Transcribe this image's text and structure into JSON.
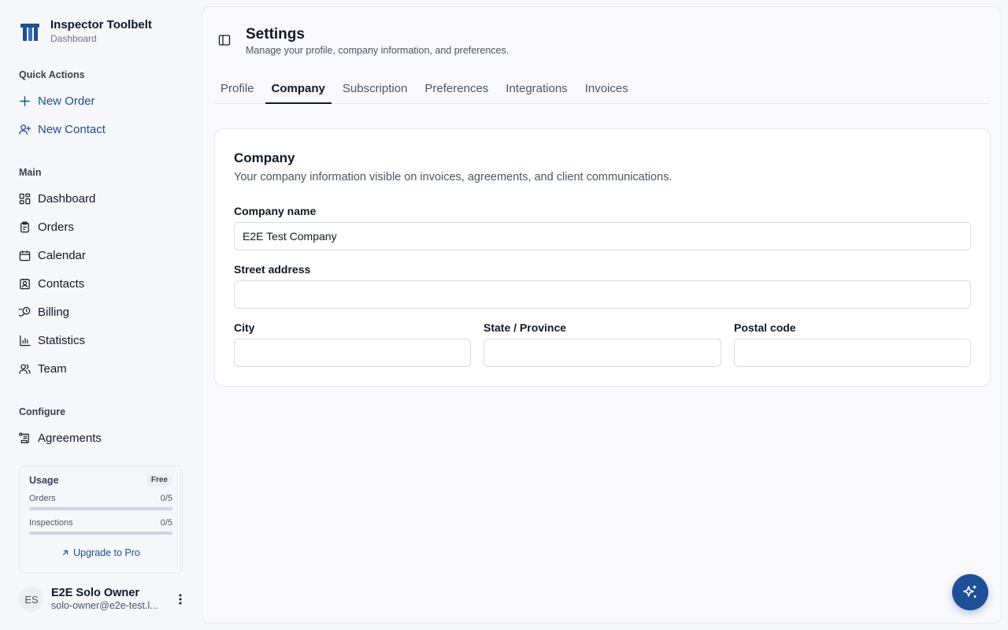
{
  "brand": {
    "title": "Inspector Toolbelt",
    "subtitle": "Dashboard"
  },
  "sidebar": {
    "quick_actions_label": "Quick Actions",
    "quick_actions": [
      {
        "label": "New Order",
        "icon": "plus-icon"
      },
      {
        "label": "New Contact",
        "icon": "user-plus-icon"
      }
    ],
    "main_label": "Main",
    "main_items": [
      {
        "label": "Dashboard",
        "icon": "dashboard-icon"
      },
      {
        "label": "Orders",
        "icon": "clipboard-icon"
      },
      {
        "label": "Calendar",
        "icon": "calendar-icon"
      },
      {
        "label": "Contacts",
        "icon": "contact-card-icon"
      },
      {
        "label": "Billing",
        "icon": "coins-icon"
      },
      {
        "label": "Statistics",
        "icon": "bar-chart-icon"
      },
      {
        "label": "Team",
        "icon": "users-icon"
      }
    ],
    "configure_label": "Configure",
    "configure_items": [
      {
        "label": "Agreements",
        "icon": "scroll-icon"
      }
    ]
  },
  "usage": {
    "title": "Usage",
    "plan_badge": "Free",
    "meters": [
      {
        "label": "Orders",
        "value": "0/5",
        "fraction": 0
      },
      {
        "label": "Inspections",
        "value": "0/5",
        "fraction": 0
      }
    ],
    "upgrade_label": "Upgrade to Pro"
  },
  "user": {
    "initials": "ES",
    "name": "E2E Solo Owner",
    "email": "solo-owner@e2e-test.l..."
  },
  "header": {
    "title": "Settings",
    "subtitle": "Manage your profile, company information, and preferences."
  },
  "tabs": [
    {
      "label": "Profile",
      "active": false
    },
    {
      "label": "Company",
      "active": true
    },
    {
      "label": "Subscription",
      "active": false
    },
    {
      "label": "Preferences",
      "active": false
    },
    {
      "label": "Integrations",
      "active": false
    },
    {
      "label": "Invoices",
      "active": false
    }
  ],
  "company_card": {
    "title": "Company",
    "description": "Your company information visible on invoices, agreements, and client communications.",
    "fields": {
      "company_name": {
        "label": "Company name",
        "value": "E2E Test Company"
      },
      "street_address": {
        "label": "Street address",
        "value": ""
      },
      "city": {
        "label": "City",
        "value": ""
      },
      "state": {
        "label": "State / Province",
        "value": ""
      },
      "postal_code": {
        "label": "Postal code",
        "value": ""
      }
    }
  },
  "colors": {
    "accent": "#1e4e8c",
    "fab": "#1f4f96",
    "background": "#f6f7fb"
  },
  "fab": {
    "icon": "sparkles-icon"
  }
}
